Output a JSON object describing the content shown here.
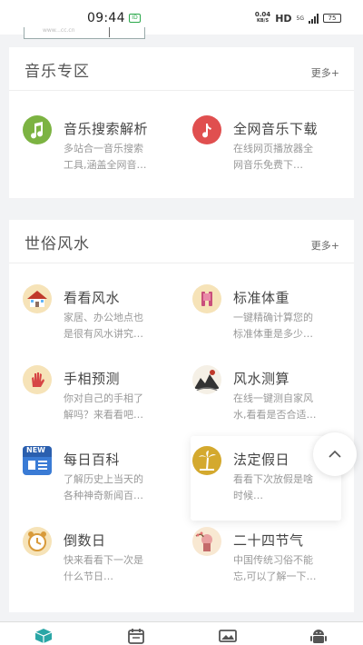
{
  "status_bar": {
    "time": "09:44",
    "chip_label": "ID",
    "net_speed": "0.04",
    "net_unit": "KB/S",
    "hd": "HD",
    "signal_label": "5G",
    "battery": "75"
  },
  "top_stub": {
    "text": "www...cc.cn"
  },
  "music": {
    "title": "音乐专区",
    "more": "更多+",
    "items": [
      {
        "title": "音乐搜索解析",
        "desc1": "多站合一音乐搜索",
        "desc2": "工具,涵盖全网音…",
        "icon": "music-note-icon",
        "color": "#7cb342"
      },
      {
        "title": "全网音乐下载",
        "desc1": "在线网页播放器全",
        "desc2": "网音乐免费下…",
        "icon": "music-note-icon",
        "color": "#e04f4f"
      }
    ]
  },
  "fengshui": {
    "title": "世俗风水",
    "more": "更多+",
    "items": [
      {
        "title": "看看风水",
        "desc1": "家居、办公地点也",
        "desc2": "是很有风水讲究…",
        "icon": "house-icon"
      },
      {
        "title": "标准体重",
        "desc1": "一键精确计算您的",
        "desc2": "标准体重是多少…",
        "icon": "body-icon"
      },
      {
        "title": "手相预测",
        "desc1": "你对自己的手相了",
        "desc2": "解吗？来看看吧…",
        "icon": "palm-icon"
      },
      {
        "title": "风水测算",
        "desc1": "在线一键测自家风",
        "desc2": "水,看看是否合适…",
        "icon": "ink-landscape-icon"
      },
      {
        "title": "每日百科",
        "desc1": "了解历史上当天的",
        "desc2": "各种神奇新闻百…",
        "icon": "newspaper-icon",
        "badge": "NEW"
      },
      {
        "title": "法定假日",
        "desc1": "看看下次放假是啥",
        "desc2": "时候…",
        "icon": "palm-tree-icon"
      },
      {
        "title": "倒数日",
        "desc1": "快来看看下一次是",
        "desc2": "什么节日…",
        "icon": "alarm-clock-icon"
      },
      {
        "title": "二十四节气",
        "desc1": "中国传统习俗不能",
        "desc2": "忘,可以了解一下…",
        "icon": "solar-term-icon"
      }
    ]
  },
  "bottom_nav": {
    "tabs": [
      {
        "icon": "cube-icon",
        "active": true,
        "color": "#2aa6a6"
      },
      {
        "icon": "calendar-icon",
        "active": false,
        "color": "#555"
      },
      {
        "icon": "image-icon",
        "active": false,
        "color": "#555"
      },
      {
        "icon": "android-icon",
        "active": false,
        "color": "#555"
      }
    ]
  }
}
